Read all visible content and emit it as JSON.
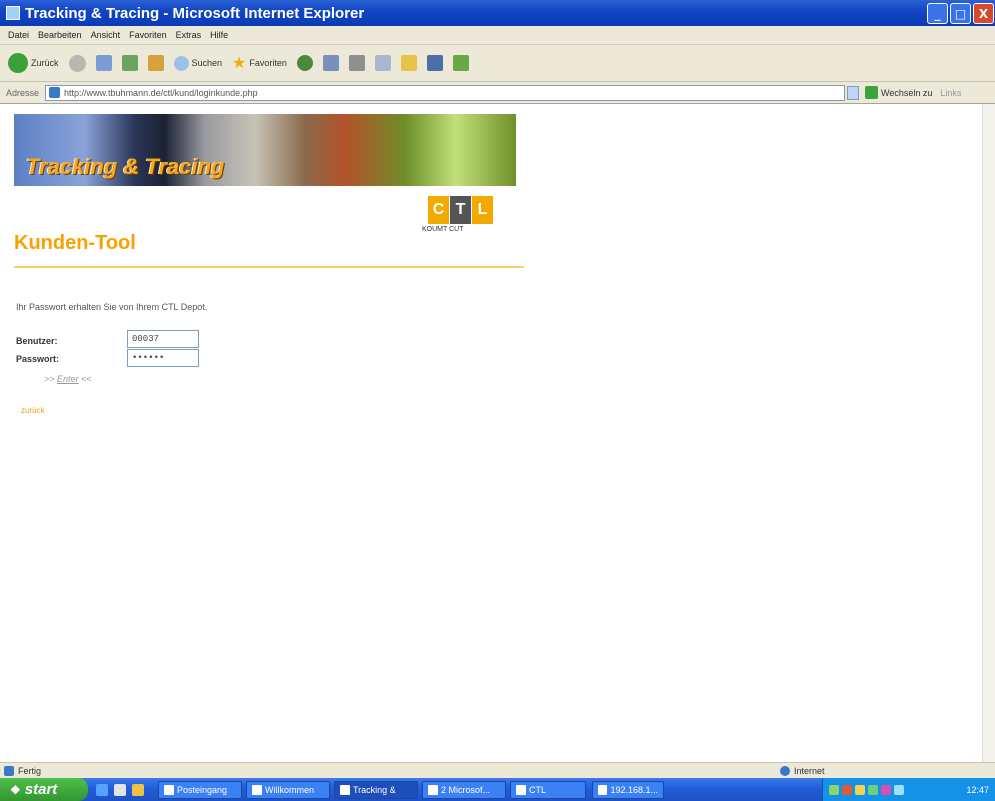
{
  "window": {
    "title": "Tracking & Tracing - Microsoft Internet Explorer",
    "buttons": [
      "_",
      "□",
      "X"
    ]
  },
  "menu": [
    "Bearbeiten",
    "Ansicht",
    "Favoriten",
    "Extras",
    "Hilfe"
  ],
  "menu_first": "Datei",
  "toolbar": {
    "back": "Zurück",
    "search": "Suchen",
    "favorites": "Favoriten"
  },
  "address": {
    "label": "Adresse",
    "url": "http://www.tbuhmann.de/ctl/kund/loginkunde.php",
    "go": "Wechseln zu",
    "links": "Links"
  },
  "banner": {
    "text": "Tracking & Tracing"
  },
  "logo": {
    "letters": [
      "C",
      "T",
      "L"
    ],
    "sub": "KOUMT CUT",
    "colors": [
      "#f2a900",
      "#555555",
      "#f2a900"
    ]
  },
  "page": {
    "title": "Kunden-Tool",
    "info": "Ihr Passwort erhalten Sie von Ihrem CTL Depot.",
    "username_label": "Benutzer:",
    "username_value": "00037",
    "password_label": "Passwort:",
    "password_value": "••••••",
    "enter_prefix": ">> ",
    "enter_label": "Enter",
    "enter_suffix": " <<",
    "back_link": "zurück"
  },
  "status": {
    "left": "Fertig",
    "zone": "Internet"
  },
  "taskbar": {
    "start": "start",
    "tasks": [
      "Posteingang",
      "Willkommen",
      "Tracking &",
      "2 Microsof...",
      "CTL",
      "192.168.1..."
    ],
    "clock": "12:47"
  },
  "accent_color": "#f5a300"
}
